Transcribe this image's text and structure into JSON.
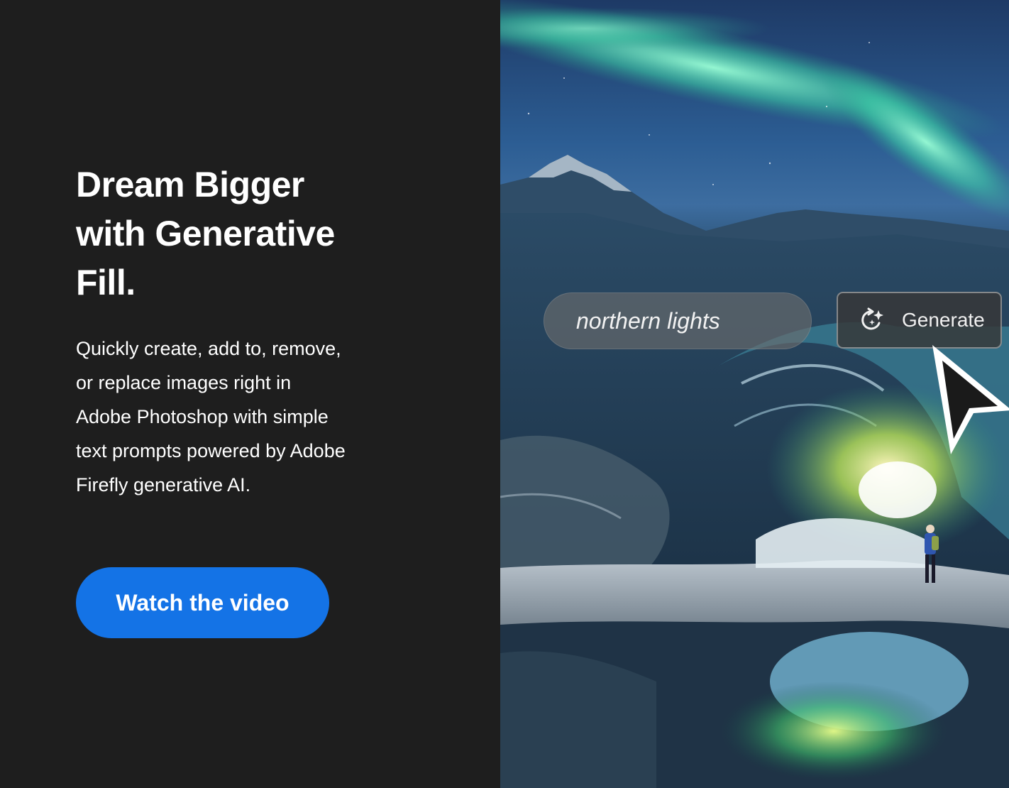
{
  "promo": {
    "headline": "Dream Bigger with Generative Fill.",
    "body": "Quickly create, add to, remove, or replace images right in Adobe Photoshop with simple text prompts powered by Adobe Firefly generative AI.",
    "cta_label": "Watch the video"
  },
  "demo_image": {
    "prompt_text": "northern lights",
    "generate_label": "Generate",
    "generate_icon": "sparkle-refresh-icon",
    "cursor_icon": "arrow-cursor-icon"
  },
  "colors": {
    "background": "#1e1e1e",
    "cta_blue": "#1473e6",
    "text": "#ffffff"
  }
}
